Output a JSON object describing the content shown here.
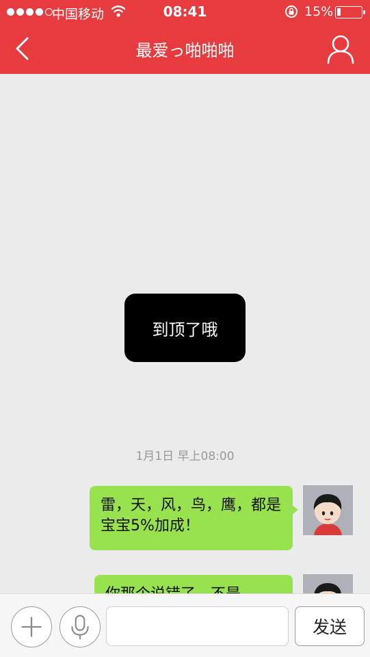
{
  "status_bar": {
    "carrier": "中国移动",
    "time": "08:41",
    "battery_percent": "15%",
    "battery_level": 0.15,
    "signal_bars_filled": 4,
    "signal_bars_total": 5
  },
  "nav": {
    "title": "最爱っ啪啪啪",
    "back_icon": "chevron-left-icon",
    "profile_icon": "person-outline-icon"
  },
  "chat": {
    "toast": "到顶了哦",
    "timestamp": "1月1日 早上08:00",
    "messages": [
      {
        "text": "雷，天，风，鸟，鹰，都是宝宝5%加成！",
        "sender": "self"
      },
      {
        "text": "你那个说错了，不是",
        "sender": "self"
      }
    ]
  },
  "input_bar": {
    "plus_icon": "plus-icon",
    "voice_icon": "microphone-icon",
    "input_value": "",
    "input_placeholder": "",
    "send_label": "发送"
  },
  "colors": {
    "header_bg": "#e63b3f",
    "bubble_bg": "#99e24f",
    "chat_bg": "#ebebeb"
  }
}
